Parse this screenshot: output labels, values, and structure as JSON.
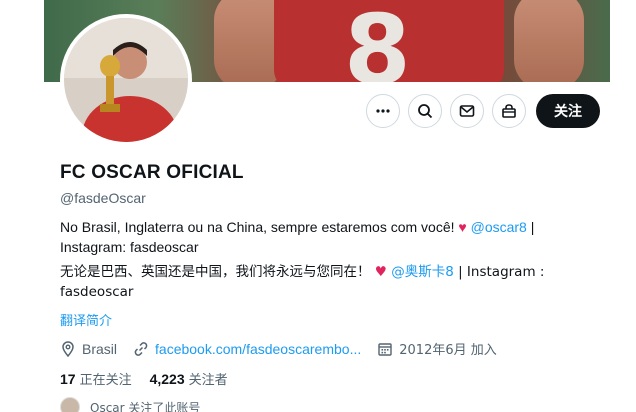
{
  "banner": {
    "jersey_number": "8"
  },
  "actions": {
    "more": "more-icon",
    "search": "search-icon",
    "message": "mail-icon",
    "shop": "shop-icon",
    "follow_label": "关注"
  },
  "profile": {
    "display_name": "FC OSCAR OFICIAL",
    "handle": "@fasdeOscar",
    "bio_pt_text": "No Brasil, Inglaterra ou na China, sempre estaremos com você! ",
    "bio_pt_heart": "♥",
    "bio_pt_mention": "@oscar8",
    "bio_pt_rest": " | Instagram: fasdeoscar",
    "bio_cn_text": "无论是巴西、英国还是中国，我们将永远与您同在！ ",
    "bio_cn_heart": "♥",
    "bio_cn_mention": "@奥斯卡8",
    "bio_cn_rest": " | Instagram : fasdeoscar",
    "translate_label": "翻译简介",
    "location": "Brasil",
    "website": "facebook.com/fasdeoscarembo...",
    "joined": "2012年6月 加入",
    "following_count": "17",
    "following_label": "正在关注",
    "followers_count": "4,223",
    "followers_label": "关注者",
    "followed_by": "Oscar 关注了此账号"
  },
  "colors": {
    "accent": "#1d9bf0",
    "heart": "#e0245e",
    "button_dark": "#0f1419"
  }
}
